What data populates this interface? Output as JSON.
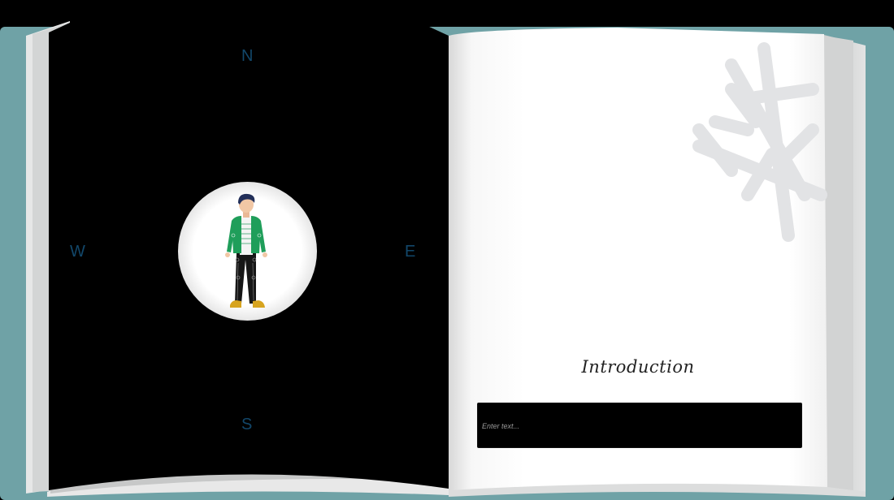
{
  "compass": {
    "north": "N",
    "south": "S",
    "west": "W",
    "east": "E"
  },
  "right_page": {
    "title": "Introduction",
    "text_input": {
      "placeholder": "Enter text...",
      "value": ""
    }
  },
  "icons": {
    "character": "person-avatar-icon",
    "decoration": "snowflake-icon"
  },
  "colors": {
    "cover": "#6fa2a6",
    "left_page": "#000000",
    "right_page": "#ffffff",
    "compass_text": "#12476a",
    "jacket": "#1f9e5a"
  }
}
